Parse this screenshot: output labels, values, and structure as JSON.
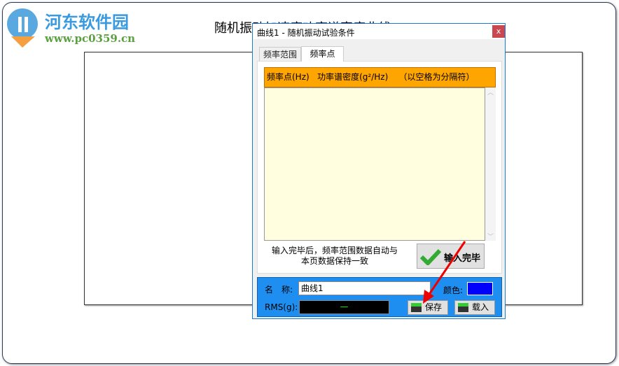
{
  "watermark": {
    "name": "河东软件园",
    "url": "www.pc0359.cn"
  },
  "main": {
    "plot_title": "随机振动加速度功率谱密度曲线"
  },
  "dialog": {
    "title": "曲线1 - 随机振动试验条件",
    "close": "x",
    "tabs": [
      {
        "label": "频率范围",
        "active": false
      },
      {
        "label": "频率点",
        "active": true
      }
    ],
    "table_header": "频率点(Hz)   功率谱密度(g²/Hz)    （以空格为分隔符）",
    "textarea_value": "",
    "hint_line1": "输入完毕后，频率范围数据自动与",
    "hint_line2": "本页数据保持一致",
    "done_button": "输入完毕",
    "name_label": "名　称:",
    "name_value": "曲线1",
    "color_label": "颜色:",
    "color_value": "#0000ff",
    "rms_label": "RMS(g):",
    "rms_value": "—",
    "save_button": "保存",
    "load_button": "载入"
  }
}
